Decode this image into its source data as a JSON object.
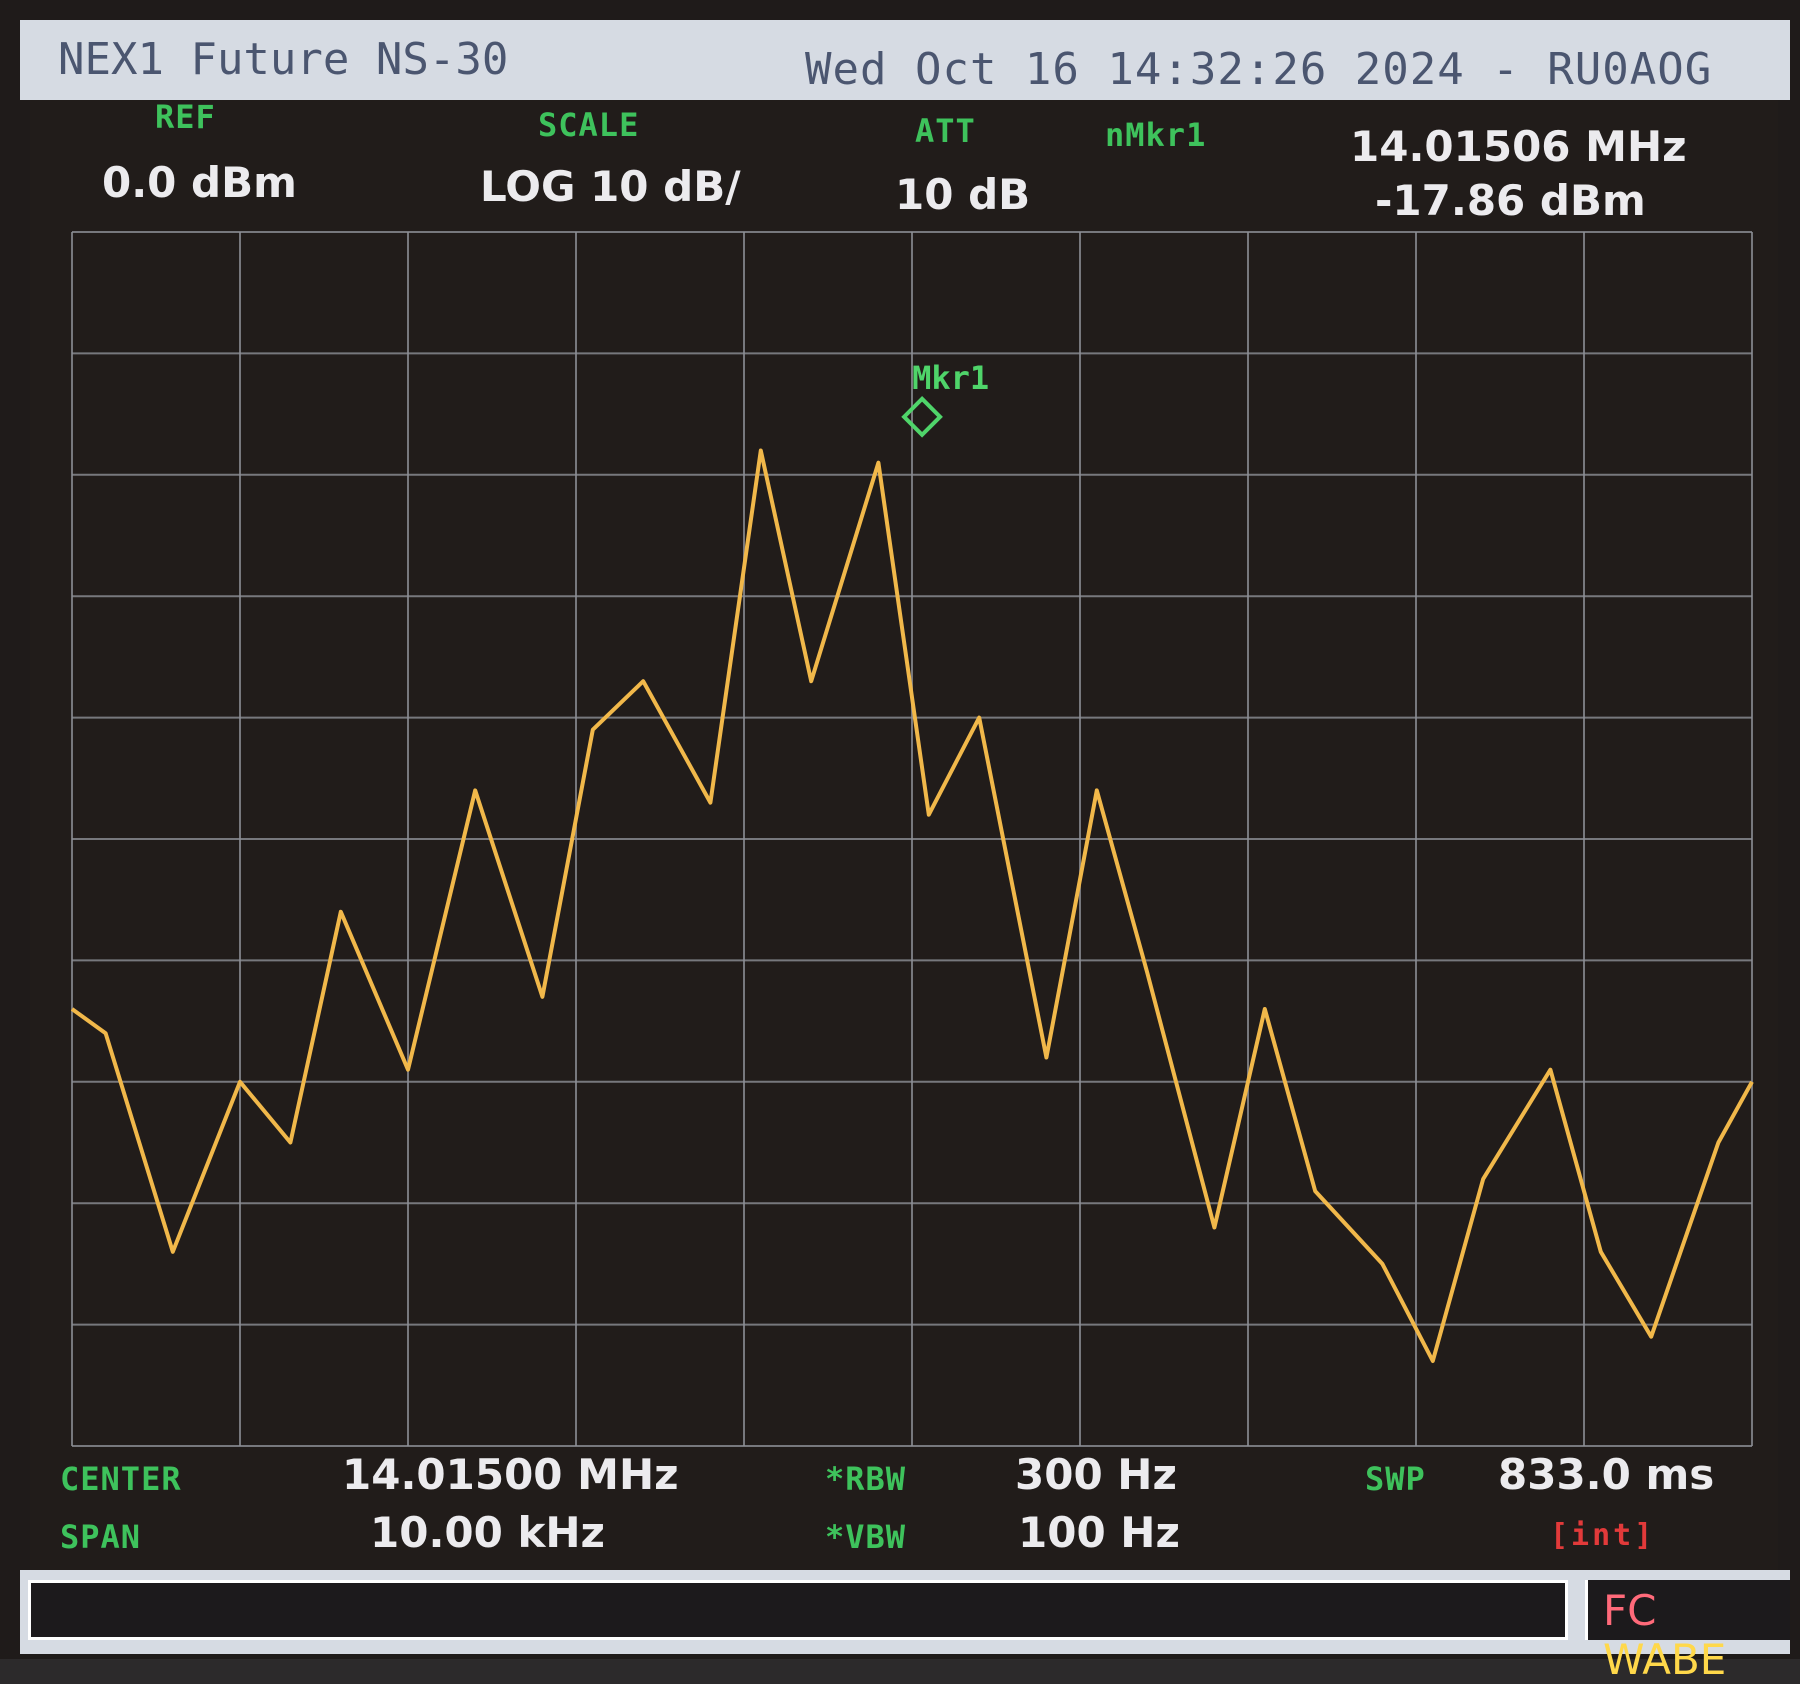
{
  "title_bar": {
    "app_name": "NEX1 Future NS-30",
    "datetime_callsign": "Wed Oct 16 14:32:26 2024 - RU0AOG"
  },
  "header": {
    "ref_label": "REF",
    "ref_value": "0.0 dBm",
    "scale_label": "SCALE",
    "scale_value": "LOG 10 dB/",
    "att_label": "ATT",
    "att_value": "10 dB",
    "marker_label": "nMkr1",
    "marker_freq": "14.01506 MHz",
    "marker_level": "-17.86 dBm"
  },
  "footer": {
    "center_label": "CENTER",
    "center_value": "14.01500 MHz",
    "span_label": "SPAN",
    "span_value": "10.00 kHz",
    "rbw_label": "*RBW",
    "rbw_value": "300 Hz",
    "vbw_label": "*VBW",
    "vbw_value": "100 Hz",
    "swp_label": "SWP",
    "swp_value": "833.0 ms",
    "trigger": "[int]"
  },
  "status_bar": {
    "mode_a": "FC",
    "mode_b": "WABE"
  },
  "colors": {
    "trace": "#f1b84a",
    "grid": "#8d8f96",
    "label_green": "#3ec25c",
    "marker_green": "#4fd46a",
    "warning_red": "#e23a3a"
  },
  "chart_data": {
    "type": "line",
    "title": "",
    "xlabel": "",
    "ylabel": "",
    "x_unit": "MHz",
    "y_unit": "dBm",
    "xlim": [
      14.01,
      14.02
    ],
    "ylim": [
      -100,
      0
    ],
    "grid": true,
    "grid_divisions": {
      "x": 10,
      "y": 10
    },
    "marker": {
      "label": "Mkr1",
      "x": 14.01506,
      "y": -17.86
    },
    "series": [
      {
        "x": [
          14.01,
          14.0102,
          14.0106,
          14.011,
          14.0113,
          14.0116,
          14.012,
          14.0124,
          14.0128,
          14.0131,
          14.0134,
          14.0138,
          14.0141,
          14.0144,
          14.0148,
          14.0151,
          14.0154,
          14.0158,
          14.0161,
          14.0164,
          14.0168,
          14.0171,
          14.0174,
          14.0178,
          14.0181,
          14.0184,
          14.0188,
          14.0191,
          14.0194,
          14.0198,
          14.02
        ],
        "y": [
          -64,
          -66,
          -84,
          -70,
          -75,
          -56,
          -69,
          -46,
          -63,
          -41,
          -37,
          -47,
          -18,
          -37,
          -19,
          -48,
          -40,
          -68,
          -46,
          -61,
          -82,
          -64,
          -79,
          -85,
          -93,
          -78,
          -69,
          -84,
          -91,
          -75,
          -70
        ]
      }
    ]
  }
}
